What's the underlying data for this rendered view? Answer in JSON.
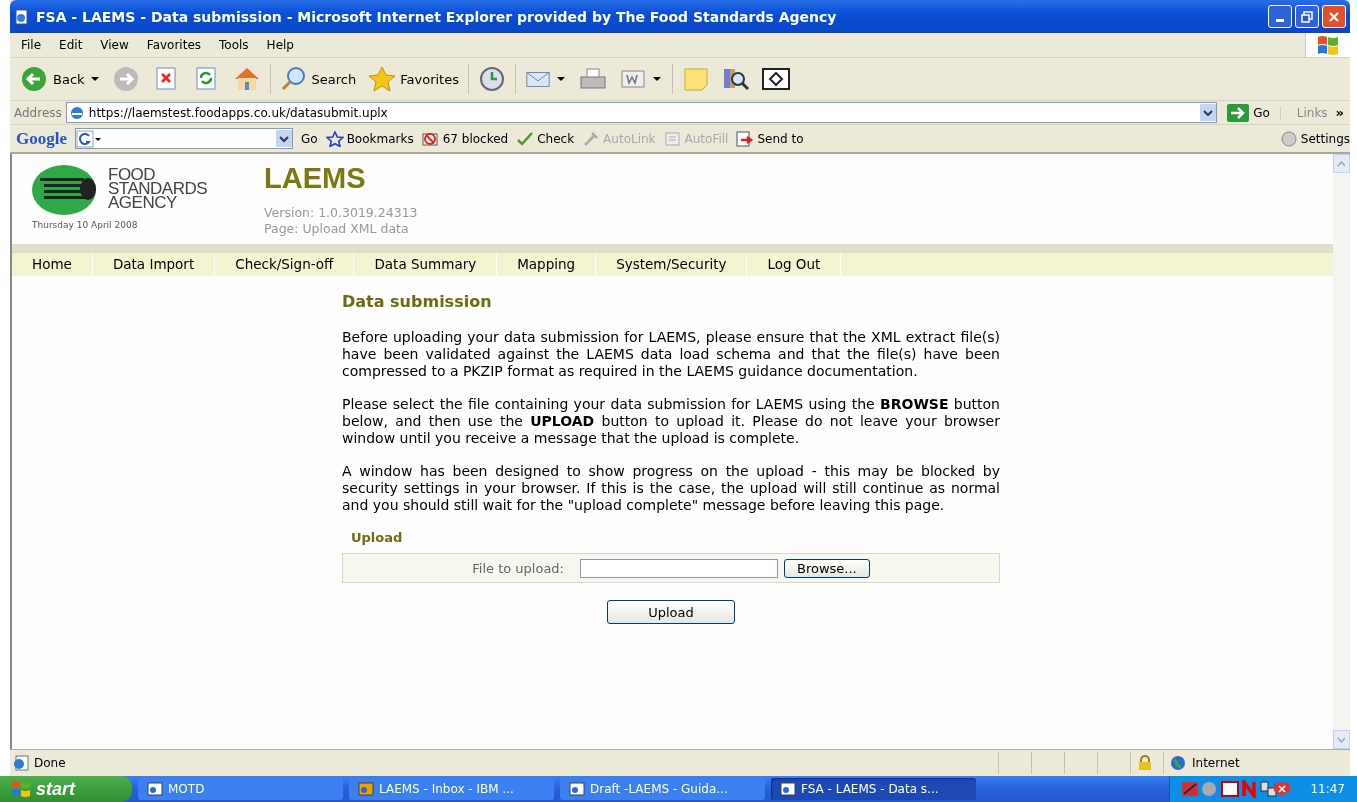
{
  "window": {
    "title": "FSA - LAEMS - Data submission - Microsoft Internet Explorer provided by The Food Standards Agency"
  },
  "menu_bar": [
    "File",
    "Edit",
    "View",
    "Favorites",
    "Tools",
    "Help"
  ],
  "toolbar": [
    {
      "kind": "back",
      "label": "Back"
    },
    {
      "kind": "forward"
    },
    {
      "kind": "stop"
    },
    {
      "kind": "refresh"
    },
    {
      "kind": "home"
    },
    {
      "kind": "search",
      "label": "Search"
    },
    {
      "kind": "favorites",
      "label": "Favorites"
    },
    {
      "kind": "history"
    },
    {
      "kind": "mail"
    },
    {
      "kind": "print"
    },
    {
      "kind": "edit"
    },
    {
      "kind": "note"
    },
    {
      "kind": "research"
    },
    {
      "kind": "window"
    }
  ],
  "address": {
    "label": "Address",
    "value": "https://laemstest.foodapps.co.uk/datasubmit.uplx",
    "go": "Go",
    "links": "Links",
    "links_more": "»"
  },
  "google_toolbar_logo": "Google",
  "google_toolbar": [
    {
      "kind": "go",
      "label": "Go",
      "disabled": false
    },
    {
      "kind": "bookmarks",
      "label": "Bookmarks",
      "disabled": false
    },
    {
      "kind": "blocked",
      "label": "67 blocked",
      "disabled": false
    },
    {
      "kind": "check",
      "label": "Check",
      "disabled": false
    },
    {
      "kind": "autolink",
      "label": "AutoLink",
      "disabled": true
    },
    {
      "kind": "autofill",
      "label": "AutoFill",
      "disabled": true
    },
    {
      "kind": "sendto",
      "label": "Send to",
      "disabled": false
    },
    {
      "kind": "settings",
      "label": "Settings",
      "disabled": false
    }
  ],
  "page": {
    "logo_lines": [
      "FOOD",
      "STANDARDS",
      "AGENCY"
    ],
    "date": "Thursday 10 April 2008",
    "app_title": "LAEMS",
    "version": "Version: 1.0.3019.24313",
    "page_label": "Page: Upload XML data",
    "nav": [
      "Home",
      "Data Import",
      "Check/Sign-off",
      "Data Summary",
      "Mapping",
      "System/Security",
      "Log Out"
    ],
    "heading": "Data submission",
    "paragraphs": [
      "Before uploading your data submission for LAEMS, please ensure that the XML extract file(s) have been validated against the LAEMS data load schema and that the file(s) have been compressed to a PKZIP format as required in the LAEMS guidance documentation.",
      "Please select the file containing your data submission for LAEMS using the **BROWSE** button below, and then use the **UPLOAD** button to upload it. Please do not leave your browser window until you receive a message that the upload is complete.",
      "A window has been designed to show progress on the upload - this may be blocked by security settings in your browser. If this is the case, the upload will still continue as normal and you should still wait for the \"upload complete\" message before leaving this page."
    ],
    "upload": {
      "title": "Upload",
      "field_label": "File to upload:",
      "browse": "Browse...",
      "submit": "Upload"
    }
  },
  "status_bar": {
    "text": "Done",
    "zone": "Internet"
  },
  "taskbar": {
    "start": "start",
    "tasks": [
      {
        "label": "MOTD",
        "selected": false
      },
      {
        "label": "LAEMS - Inbox - IBM ...",
        "selected": false
      },
      {
        "label": "Draft -LAEMS - Guida...",
        "selected": false
      },
      {
        "label": "FSA - LAEMS - Data s...",
        "selected": true
      }
    ],
    "clock": "11:47"
  }
}
